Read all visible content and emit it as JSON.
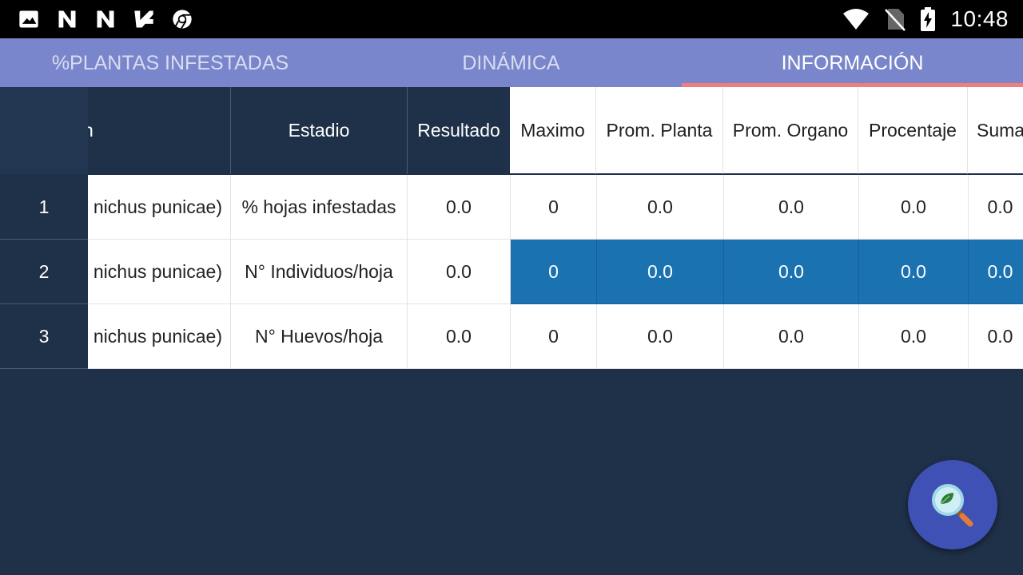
{
  "status_bar": {
    "time": "10:48",
    "left_icons": [
      "image-icon",
      "n-app-icon",
      "n-app-icon",
      "checkmark-app-icon",
      "chrome-icon"
    ],
    "right_icons": [
      "wifi-icon",
      "no-sim-icon",
      "battery-charging-icon"
    ]
  },
  "tabs": [
    {
      "label": "%PLANTAS INFESTADAS",
      "active": false
    },
    {
      "label": "DINÁMICA",
      "active": false
    },
    {
      "label": "INFORMACIÓN",
      "active": true
    }
  ],
  "table": {
    "columns": [
      "Estadio",
      "Resultado",
      "Maximo",
      "Prom. Planta",
      "Prom. Organo",
      "Procentaje",
      "Suma"
    ],
    "rows": [
      {
        "num": "1",
        "name": "nichus punicae)",
        "estadio": "% hojas infestadas",
        "resultado": "0.0",
        "maximo": "0",
        "prom_planta": "0.0",
        "prom_organo": "0.0",
        "procentaje": "0.0",
        "suma": "0.0"
      },
      {
        "num": "2",
        "name": "nichus punicae)",
        "estadio": "N° Individuos/hoja",
        "resultado": "0.0",
        "maximo": "0",
        "prom_planta": "0.0",
        "prom_organo": "0.0",
        "procentaje": "0.0",
        "suma": "0.0"
      },
      {
        "num": "3",
        "name": "nichus punicae)",
        "estadio": "N° Huevos/hoja",
        "resultado": "0.0",
        "maximo": "0",
        "prom_planta": "0.0",
        "prom_organo": "0.0",
        "procentaje": "0.0",
        "suma": "0.0"
      }
    ],
    "selected_row": "2"
  },
  "fab": {
    "icon": "magnifier-leaf-icon"
  },
  "colors": {
    "background": "#1f3049",
    "tabbar": "#7986cb",
    "tab_indicator": "#ef7f7f",
    "selected_row": "#1b72b0",
    "fab": "#3f51b5"
  }
}
